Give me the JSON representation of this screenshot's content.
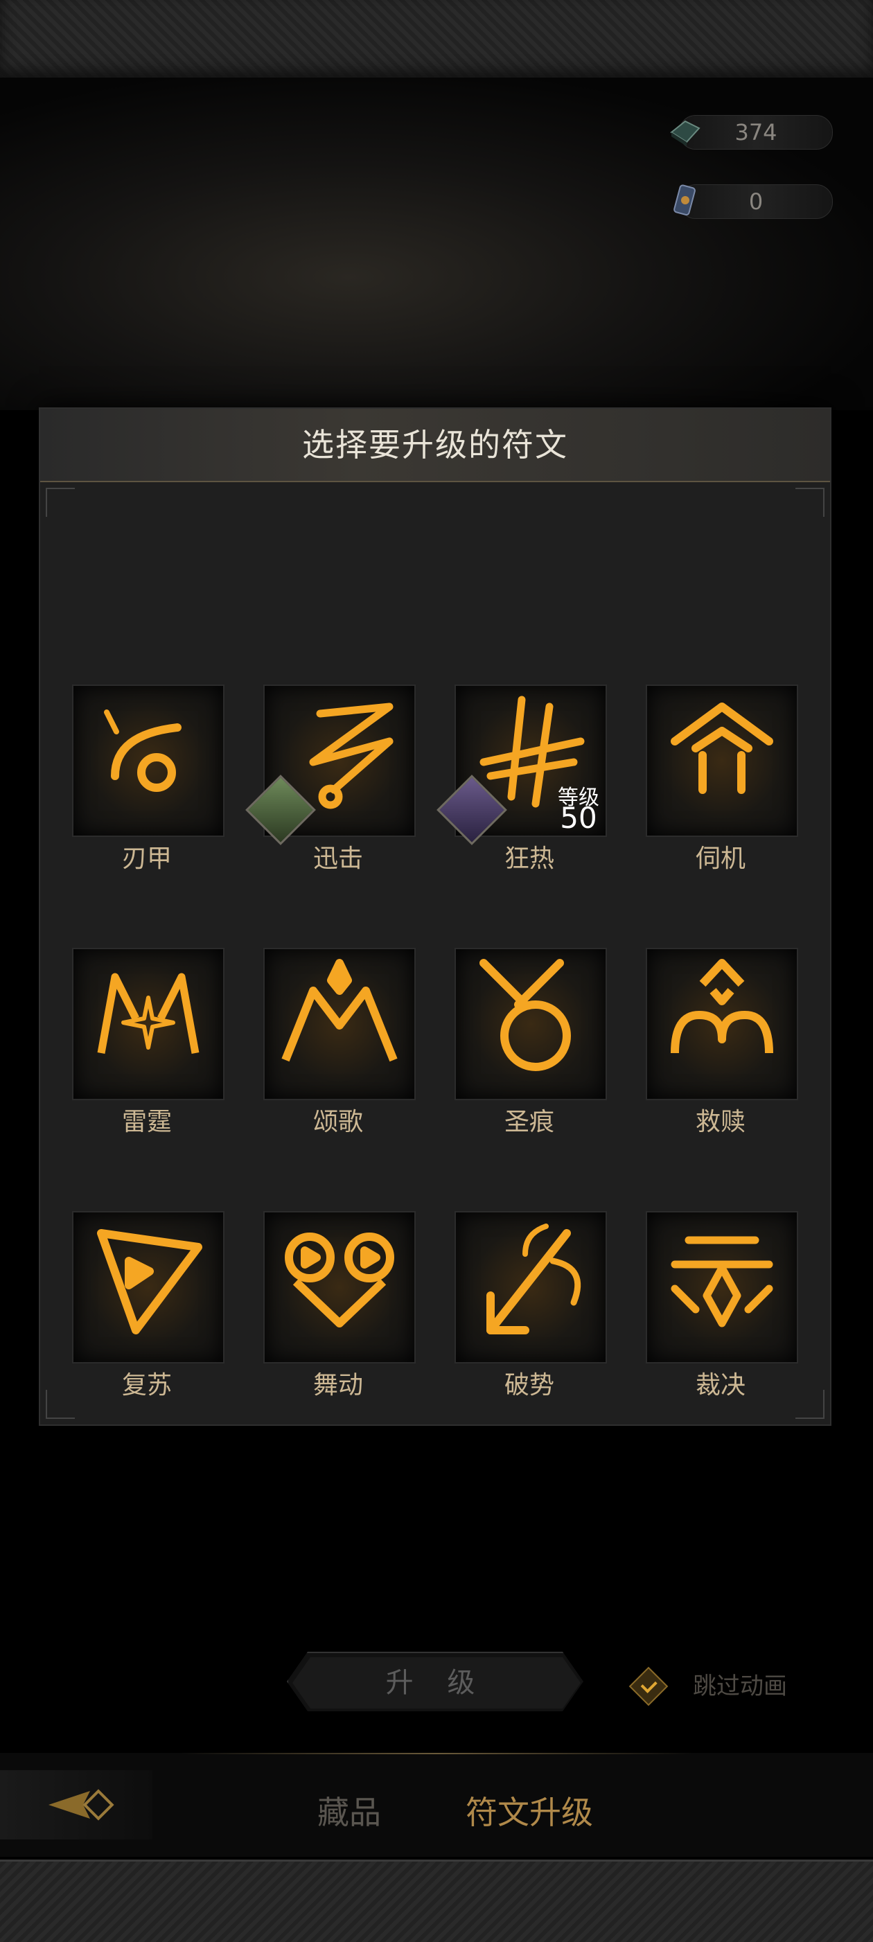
{
  "currencies": [
    {
      "icon": "rune-stone-icon",
      "value": "374"
    },
    {
      "icon": "rune-scroll-icon",
      "value": "0"
    }
  ],
  "dialog": {
    "title": "选择要升级的符文",
    "runes": [
      {
        "name": "刃甲",
        "icon": "blade-armor-rune-icon"
      },
      {
        "name": "迅击",
        "icon": "swift-strike-rune-icon",
        "hero_badge": "hero-avatar-green"
      },
      {
        "name": "狂热",
        "icon": "frenzy-rune-icon",
        "hero_badge": "hero-avatar-purple",
        "level_label": "等级",
        "level": "50"
      },
      {
        "name": "伺机",
        "icon": "opportunity-rune-icon"
      },
      {
        "name": "雷霆",
        "icon": "thunder-rune-icon"
      },
      {
        "name": "颂歌",
        "icon": "hymn-rune-icon"
      },
      {
        "name": "圣痕",
        "icon": "stigmata-rune-icon"
      },
      {
        "name": "救赎",
        "icon": "redemption-rune-icon"
      },
      {
        "name": "复苏",
        "icon": "revival-rune-icon"
      },
      {
        "name": "舞动",
        "icon": "dance-rune-icon"
      },
      {
        "name": "破势",
        "icon": "break-rune-icon"
      },
      {
        "name": "裁决",
        "icon": "judgment-rune-icon"
      }
    ]
  },
  "actions": {
    "upgrade_label": "升 级",
    "skip_animation_label": "跳过动画",
    "skip_animation_checked": true
  },
  "tabs": [
    {
      "label": "藏品",
      "active": false
    },
    {
      "label": "符文升级",
      "active": true
    }
  ],
  "colors": {
    "accent_gold": "#e0a733",
    "rune_glow": "#f5a623",
    "active_tab": "#b0894a",
    "inactive_tab": "#5a5650"
  }
}
